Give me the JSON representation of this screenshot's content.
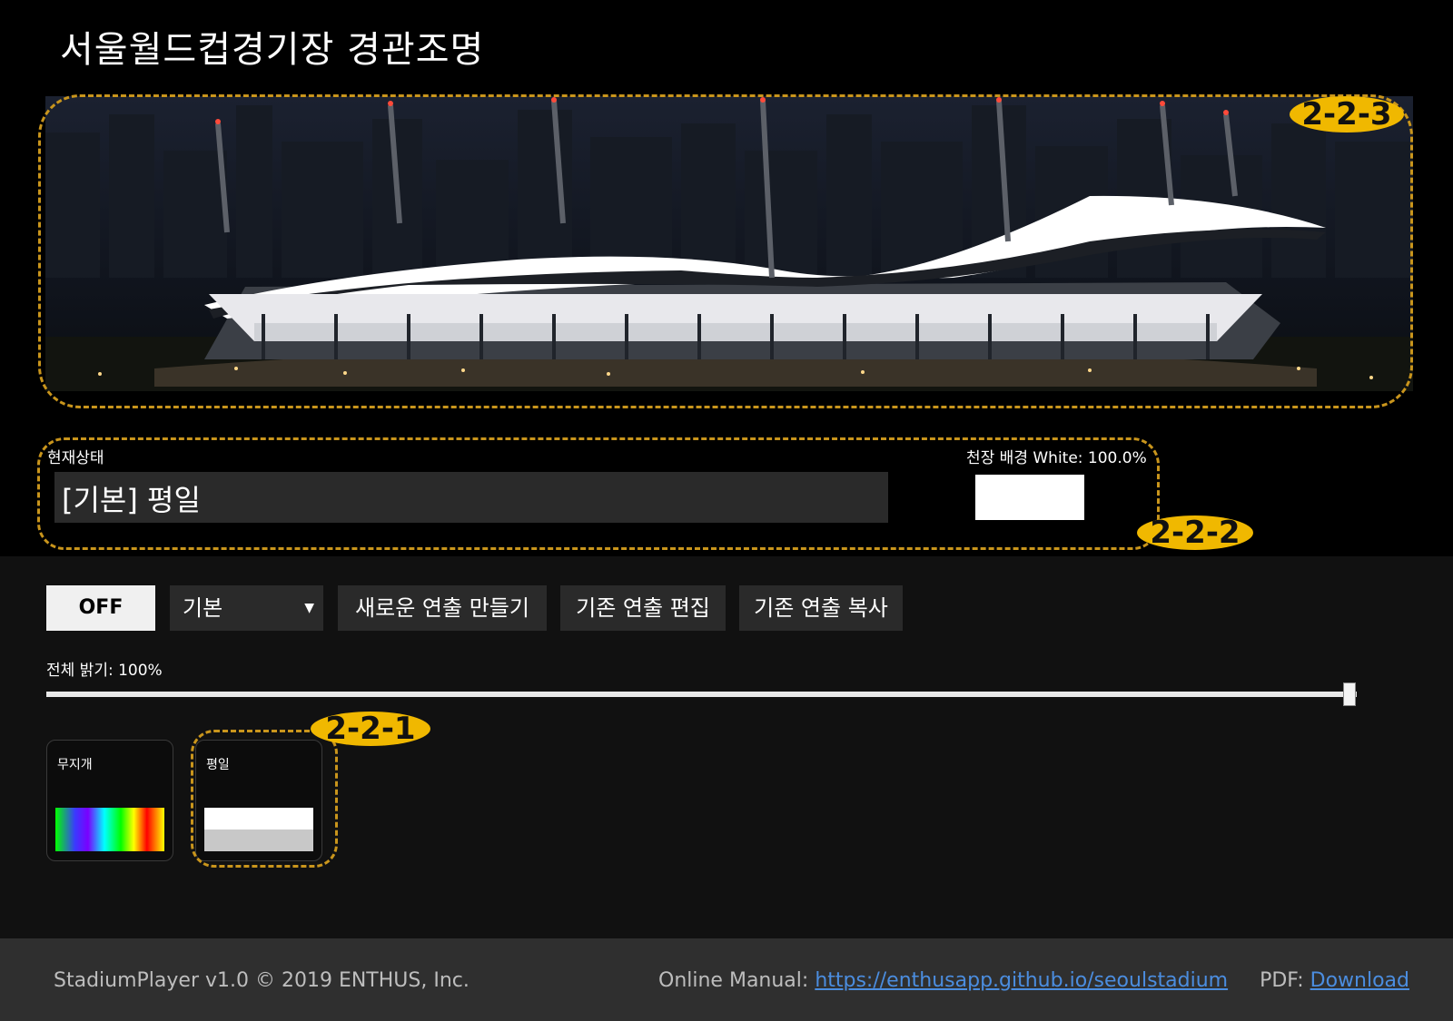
{
  "app": {
    "title": "서울월드컵경기장 경관조명"
  },
  "annotations": {
    "hero": "2-2-3",
    "status": "2-2-2",
    "scene": "2-2-1"
  },
  "status": {
    "label": "현재상태",
    "value": "[기본] 평일",
    "ceiling_label": "천장 배경 White: 100.0%",
    "ceiling_color": "#ffffff"
  },
  "toolbar": {
    "off_label": "OFF",
    "group_select_value": "기본",
    "new_label": "새로운 연출 만들기",
    "edit_label": "기존 연출 편집",
    "copy_label": "기존 연출 복사"
  },
  "brightness": {
    "label": "전체 밝기: 100%",
    "value": 1.0
  },
  "scenes": [
    {
      "name": "무지개",
      "preview": "rainbow"
    },
    {
      "name": "평일",
      "preview": "white-gray"
    }
  ],
  "footer": {
    "copyright": "StadiumPlayer v1.0 © 2019 ENTHUS, Inc.",
    "manual_label": "Online Manual:",
    "manual_link": "https://enthusapp.github.io/seoulstadium",
    "pdf_label": "PDF:",
    "pdf_link": "Download"
  },
  "colors": {
    "accent": "#c9951c",
    "badge": "#f0b800",
    "link": "#4b8ddf"
  }
}
